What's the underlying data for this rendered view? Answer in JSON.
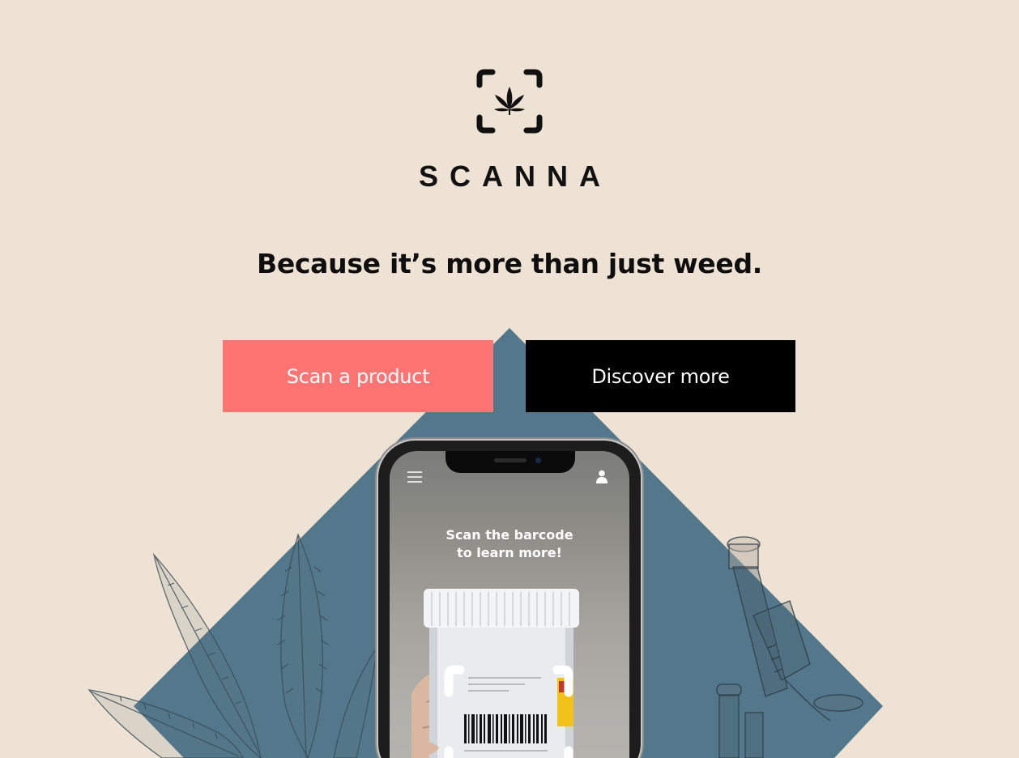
{
  "brand": {
    "name": "SCANNA",
    "logo_icon": "scan-frame-leaf-icon"
  },
  "hero": {
    "tagline": "Because it’s more than just weed.",
    "primary_button": "Scan a product",
    "secondary_button": "Discover more"
  },
  "phone_screen": {
    "prompt_line1": "Scan the barcode",
    "prompt_line2": "to learn more!",
    "menu_icon": "hamburger-menu-icon",
    "user_icon": "user-icon"
  },
  "colors": {
    "background": "#ede2d3",
    "accent": "#fe7472",
    "dark": "#000000",
    "diamond": "#53788c"
  }
}
